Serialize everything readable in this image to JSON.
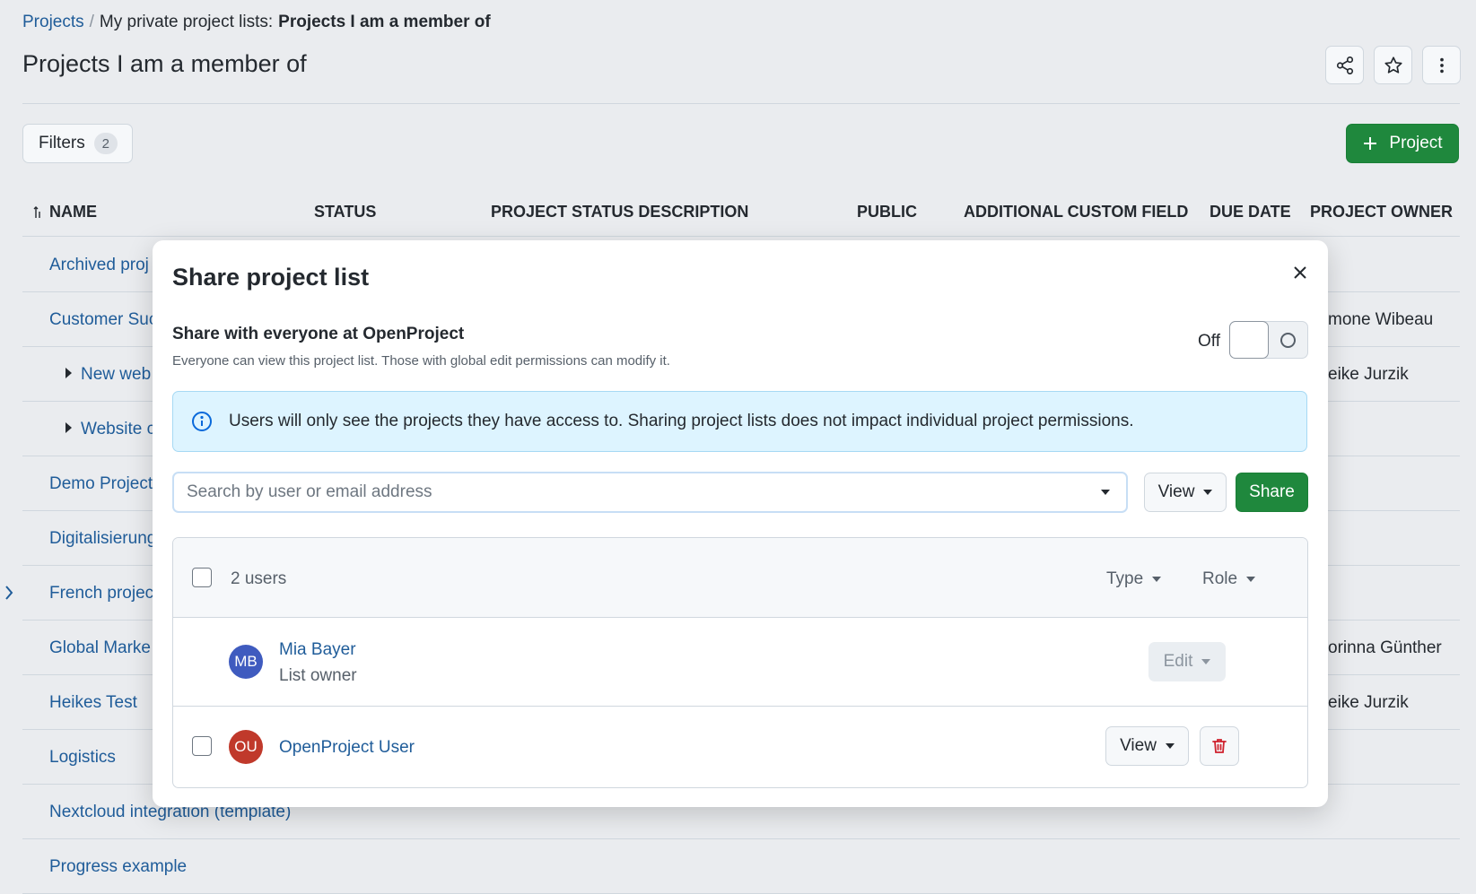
{
  "breadcrumb": {
    "root": "Projects",
    "separator": "/",
    "prefix": "My private project lists:",
    "current": "Projects I am a member of"
  },
  "page_title": "Projects I am a member of",
  "header_actions": [
    {
      "icon": "share-icon"
    },
    {
      "icon": "star-icon"
    },
    {
      "icon": "kebab-menu-icon"
    }
  ],
  "filters": {
    "label": "Filters",
    "count": "2"
  },
  "add_project": {
    "label": "Project",
    "icon": "plus-icon"
  },
  "table": {
    "columns": [
      "NAME",
      "STATUS",
      "PROJECT STATUS DESCRIPTION",
      "PUBLIC",
      "ADDITIONAL CUSTOM FIELD",
      "DUE DATE",
      "PROJECT OWNER"
    ],
    "sort_icon": "sort-icon",
    "rows": [
      {
        "name": "Archived proj",
        "owner": ""
      },
      {
        "name": "Customer Suc",
        "owner": "mone Wibeau"
      },
      {
        "name": "New web",
        "owner": "eike Jurzik"
      },
      {
        "name": "Website c",
        "owner": ""
      },
      {
        "name": "Demo Project",
        "owner": ""
      },
      {
        "name": "Digitalisierung",
        "owner": ""
      },
      {
        "name": "French projec",
        "owner": ""
      },
      {
        "name": "Global Marke",
        "owner": "orinna Günther"
      },
      {
        "name": "Heikes Test",
        "owner": "eike Jurzik"
      },
      {
        "name": "Logistics",
        "owner": ""
      },
      {
        "name": "Nextcloud integration (template)",
        "owner": ""
      },
      {
        "name": "Progress example",
        "owner": ""
      }
    ]
  },
  "modal": {
    "title": "Share project list",
    "share_everyone": {
      "title": "Share with everyone at OpenProject",
      "description": "Everyone can view this project list. Those with global edit permissions can modify it.",
      "toggle_label": "Off"
    },
    "info": "Users will only see the projects they have access to. Sharing project lists does not impact individual project permissions.",
    "search_placeholder": "Search by user or email address",
    "role_select": "View",
    "share_label": "Share",
    "users_header": {
      "count": "2 users",
      "type_filter": "Type",
      "role_filter": "Role"
    },
    "users": [
      {
        "initials": "MB",
        "name": "Mia Bayer",
        "role": "List owner",
        "action": "Edit",
        "avatar_color": "#3f5bbf"
      },
      {
        "initials": "OU",
        "name": "OpenProject User",
        "action": "View",
        "avatar_color": "#c0392b"
      }
    ]
  },
  "colors": {
    "primary_green": "#1f883d",
    "link_blue": "#1f5c99",
    "info_bg": "#ddf4ff",
    "danger": "#cf222e"
  }
}
